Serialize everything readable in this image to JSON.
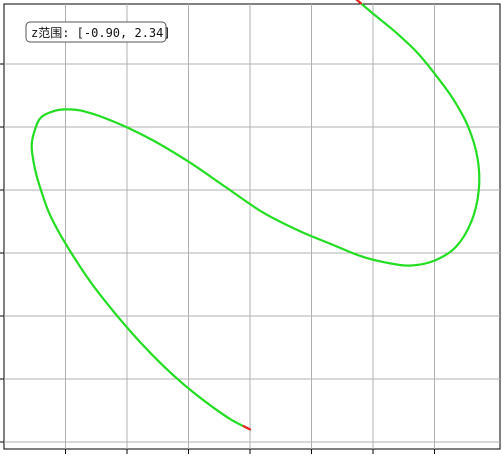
{
  "chart_data": {
    "type": "line",
    "title": "",
    "xlabel": "",
    "ylabel": "",
    "grid": true,
    "annotation": "z范围: [-0.90, 2.34]",
    "xlim": [
      0,
      8
    ],
    "ylim": [
      0,
      7
    ],
    "x_ticks": [
      1,
      2,
      3,
      4,
      5,
      6,
      7
    ],
    "y_ticks": [
      0,
      1,
      2,
      3,
      4,
      5,
      6
    ],
    "colors": {
      "curve": "#22dd22",
      "endpoint": "#ee2222",
      "grid": "#b0b0b0",
      "axes": "#000000"
    },
    "series": [
      {
        "x": [
          4.0,
          3.7,
          3.4,
          3.0,
          2.6,
          2.2,
          1.8,
          1.4,
          1.0,
          0.75,
          0.6,
          0.5,
          0.45,
          0.5,
          0.6,
          0.8,
          1.0,
          1.3,
          1.8,
          2.4,
          3.0,
          3.6,
          4.2,
          4.8,
          5.3,
          5.8,
          6.2,
          6.6,
          7.0,
          7.35,
          7.6,
          7.72,
          7.7,
          7.55,
          7.3,
          7.0,
          6.7,
          6.35,
          6.0,
          5.7
        ],
        "y": [
          0.2,
          0.35,
          0.55,
          0.85,
          1.2,
          1.6,
          2.05,
          2.55,
          3.15,
          3.6,
          4.0,
          4.35,
          4.7,
          4.95,
          5.15,
          5.25,
          5.28,
          5.25,
          5.08,
          4.8,
          4.45,
          4.05,
          3.65,
          3.35,
          3.15,
          2.95,
          2.85,
          2.8,
          2.88,
          3.1,
          3.5,
          4.0,
          4.5,
          5.0,
          5.45,
          5.85,
          6.2,
          6.52,
          6.8,
          7.05
        ]
      }
    ]
  }
}
